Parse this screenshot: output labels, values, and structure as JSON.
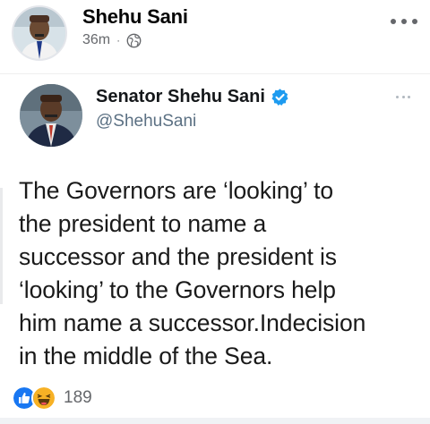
{
  "post": {
    "author": "Shehu Sani",
    "time": "36m",
    "separator": "·",
    "audience_icon": "globe-icon",
    "more_icon": "more-options-icon"
  },
  "tweet": {
    "display_name": "Senator Shehu Sani",
    "verified_icon": "verified-badge-icon",
    "handle": "@ShehuSani",
    "text_lines": [
      "The Governors are ‘looking’ to",
      "the president to name a",
      "successor and the president is",
      "‘looking’ to the Governors help",
      "him name a successor.Indecision",
      "in the middle of the Sea."
    ]
  },
  "reactions": {
    "icons": [
      "like-icon",
      "haha-icon"
    ],
    "count": "189"
  },
  "colors": {
    "facebook_blue": "#1877f2",
    "twitter_blue": "#1d9bf0",
    "meta_gray": "#65676b"
  }
}
